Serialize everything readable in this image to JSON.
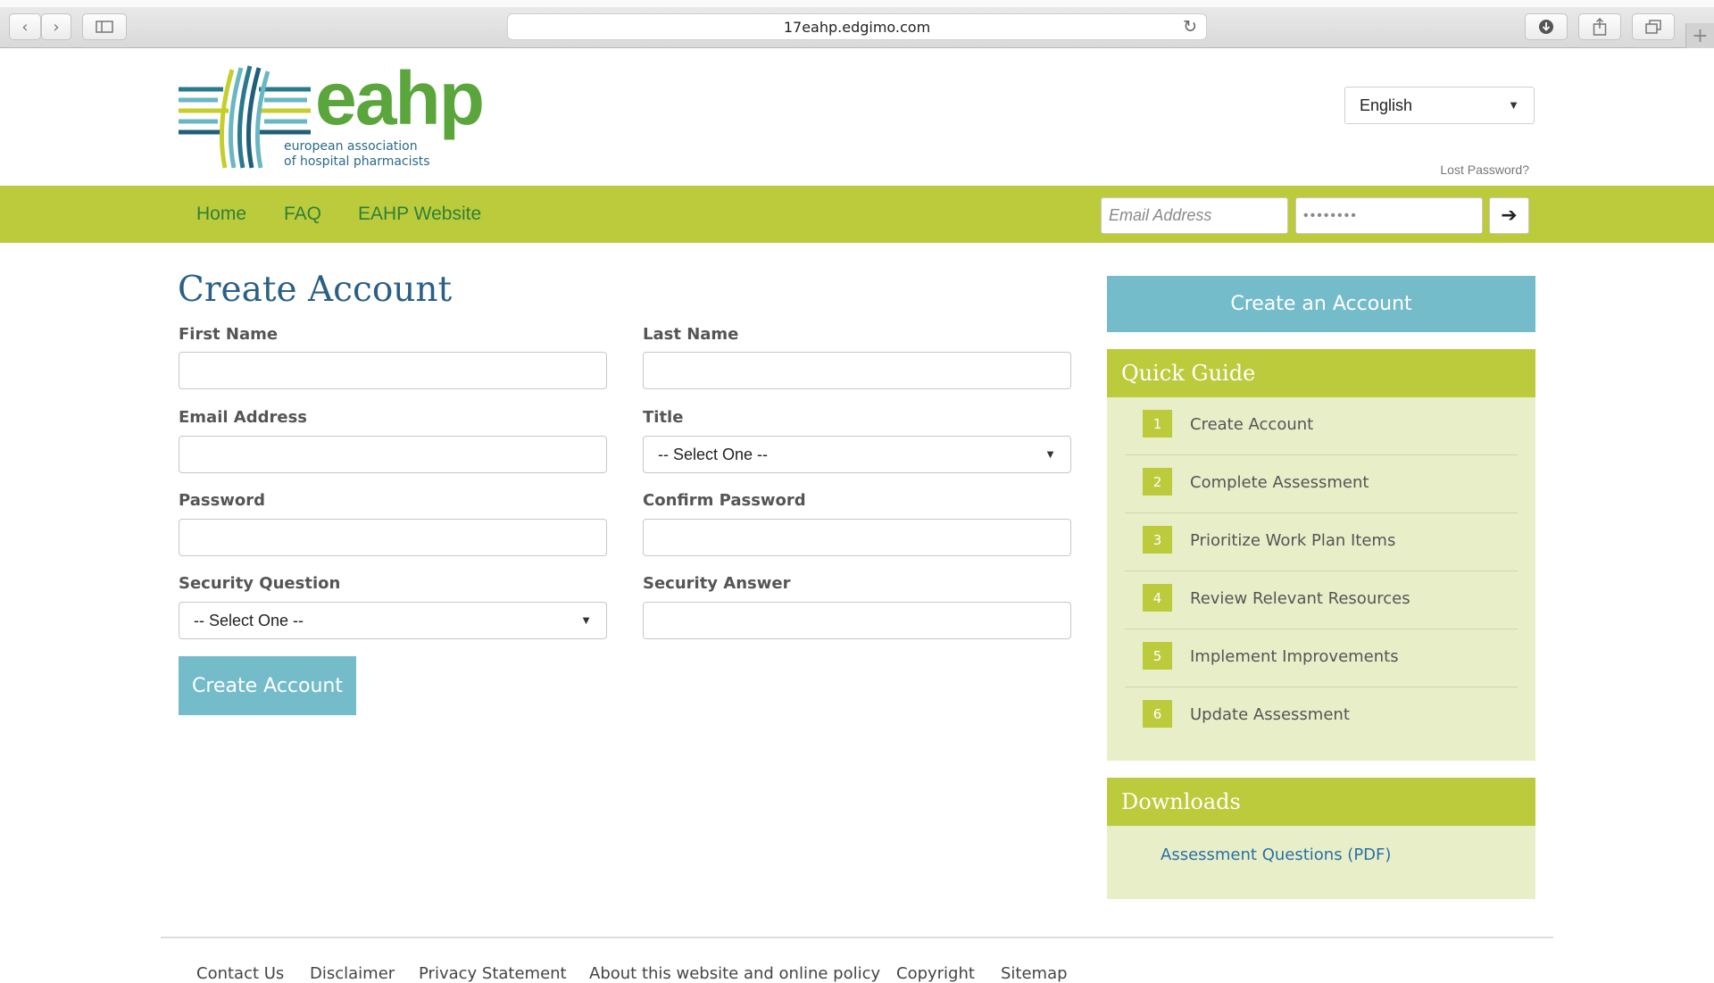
{
  "browser": {
    "url": "17eahp.edgimo.com",
    "back_glyph": "‹",
    "forward_glyph": "›",
    "reload_glyph": "↻",
    "new_tab_glyph": "+"
  },
  "header": {
    "logo_word": "eahp",
    "logo_sub_line1": "european association",
    "logo_sub_line2": "of hospital pharmacists",
    "language": "English",
    "lost_password": "Lost Password?"
  },
  "nav": {
    "items": [
      {
        "label": "Home"
      },
      {
        "label": "FAQ"
      },
      {
        "label": "EAHP Website"
      }
    ],
    "email_placeholder": "Email Address",
    "password_value": "••••••••",
    "submit_glyph": "➔"
  },
  "form": {
    "title": "Create Account",
    "first_name_label": "First Name",
    "last_name_label": "Last Name",
    "email_label": "Email Address",
    "title_label": "Title",
    "title_value": "-- Select One --",
    "password_label": "Password",
    "confirm_password_label": "Confirm Password",
    "security_question_label": "Security Question",
    "security_question_value": "-- Select One --",
    "security_answer_label": "Security Answer",
    "submit_label": "Create Account"
  },
  "sidebar": {
    "cta_label": "Create an Account",
    "quick_guide_title": "Quick Guide",
    "guide_items": [
      {
        "num": "1",
        "label": "Create Account"
      },
      {
        "num": "2",
        "label": "Complete Assessment"
      },
      {
        "num": "3",
        "label": "Prioritize Work Plan Items"
      },
      {
        "num": "4",
        "label": "Review Relevant Resources"
      },
      {
        "num": "5",
        "label": "Implement Improvements"
      },
      {
        "num": "6",
        "label": "Update Assessment"
      }
    ],
    "downloads_title": "Downloads",
    "download_link": "Assessment Questions (PDF)"
  },
  "footer": {
    "links": [
      {
        "label": "Contact Us"
      },
      {
        "label": "Disclaimer"
      },
      {
        "label": "Privacy Statement"
      },
      {
        "label": "About this website and online policy"
      },
      {
        "label": "Copyright"
      },
      {
        "label": "Sitemap"
      }
    ]
  },
  "colors": {
    "nav_green": "#bccb3c",
    "teal": "#75bccb",
    "panel_bg": "#e8efc8",
    "title_blue": "#2a5f86",
    "link_green": "#2f7f3a"
  }
}
